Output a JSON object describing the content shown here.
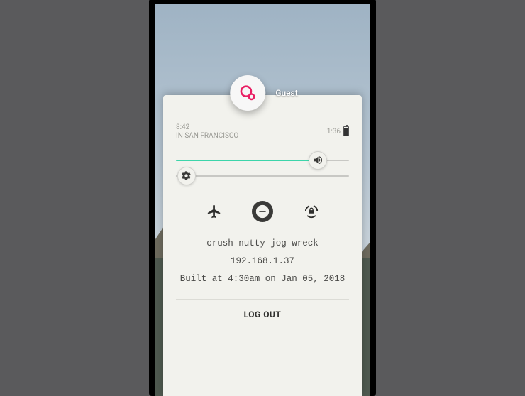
{
  "user": {
    "label": "Guest"
  },
  "status": {
    "time": "8:42",
    "location": "IN SAN FRANCISCO",
    "secondary": "1:36"
  },
  "sliders": {
    "volume_percent": 82,
    "brightness_percent": 6
  },
  "toggles": {
    "airplane": false,
    "dnd": true,
    "rotation_lock": false
  },
  "info": {
    "hostname": "crush-nutty-jog-wreck",
    "ip": "192.168.1.37",
    "build": "Built at 4:30am on Jan 05, 2018"
  },
  "actions": {
    "logout": "LOG OUT"
  },
  "colors": {
    "accent_slider": "#3dd5aa",
    "accent_logo": "#e91e63"
  }
}
